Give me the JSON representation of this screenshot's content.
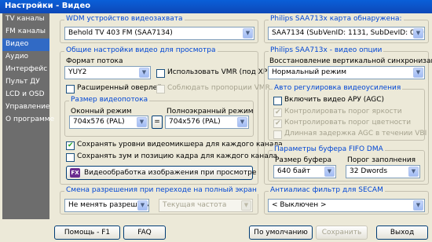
{
  "window": {
    "title": "Настройки - Видео"
  },
  "sidebar": {
    "items": [
      {
        "label": "TV каналы"
      },
      {
        "label": "FM каналы"
      },
      {
        "label": "Видео"
      },
      {
        "label": "Аудио"
      },
      {
        "label": "Интерфейс"
      },
      {
        "label": "Пульт ДУ"
      },
      {
        "label": "LCD и OSD"
      },
      {
        "label": "Управление"
      },
      {
        "label": "О программе"
      }
    ]
  },
  "wdm": {
    "title": "WDM устройство видеозахвата",
    "value": "Behold TV 403 FM (SAA7134)"
  },
  "general": {
    "title": "Общие настройки видео для просмотра",
    "format_label": "Формат потока",
    "format_value": "YUY2",
    "vmr_label": "Использовать VMR (под XP)",
    "overlay_label": "Расширенный оверлей",
    "aspect_label": "Соблюдать пропорции VMR"
  },
  "size": {
    "title": "Размер видеопотока",
    "window_label": "Оконный режим",
    "window_value": "704x576 (PAL)",
    "equals": "=",
    "full_label": "Полноэкранный режим",
    "full_value": "704x576 (PAL)"
  },
  "options": {
    "save_mixer": "Сохранять уровни видеомикшера для каждого канала",
    "save_zoom": "Сохранять зум и позицию кадра для каждого канала",
    "processing_button": "Видеообработка изображения при просмотре"
  },
  "resolution": {
    "title": "Смена разрешения при переходе на полный экран",
    "mode_value": "Не менять разрешение",
    "freq_value": "Текущая частота"
  },
  "card": {
    "title": "Philips SAA713x карта обнаружена:",
    "value": "SAA7134 (SubVenID: 1131, SubDevID: 0000)"
  },
  "philips_video": {
    "title": "Philips SAA713x - видео опции",
    "sync_label": "Восстановление вертикальной синхронизации",
    "sync_value": "Нормальный режим"
  },
  "agc": {
    "title": "Авто регулировка видеоусиления",
    "enable": "Включить видео АРУ (AGC)",
    "brightness": "Контролировать порог яркости",
    "color": "Контролировать порог цветности",
    "vbi": "Длинная задержка AGC в течении VBI"
  },
  "fifo": {
    "title": "Параметры буфера FIFO DMA",
    "size_label": "Размер буфера",
    "size_value": "640 байт",
    "threshold_label": "Порог заполнения",
    "threshold_value": "32 Dwords"
  },
  "secam": {
    "title": "Антиалиас фильтр для SECAM",
    "value": "< Выключен >"
  },
  "buttons": {
    "help": "Помощь - F1",
    "faq": "FAQ",
    "default": "По умолчанию",
    "save": "Сохранить",
    "exit": "Выход"
  }
}
